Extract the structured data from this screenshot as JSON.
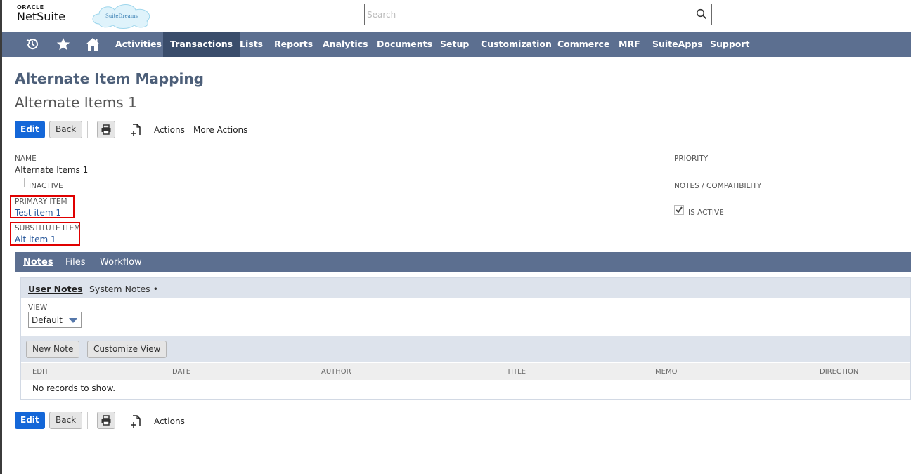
{
  "header": {
    "brand_top": "ORACLE",
    "brand_name": "NetSuite",
    "partner_logo_text": "SuiteDreams",
    "search_placeholder": "Search"
  },
  "nav": {
    "icons": [
      "recent-records-icon",
      "star-icon",
      "home-icon"
    ],
    "items": [
      "Activities",
      "Transactions",
      "Lists",
      "Reports",
      "Analytics",
      "Documents",
      "Setup",
      "Customization",
      "Commerce",
      "MRF",
      "SuiteApps",
      "Support"
    ],
    "active_item": "Transactions"
  },
  "page": {
    "title": "Alternate Item Mapping",
    "record_name": "Alternate Items 1"
  },
  "actions": {
    "edit": "Edit",
    "back": "Back",
    "actions": "Actions",
    "more_actions": "More Actions"
  },
  "fields": {
    "name_label": "NAME",
    "name_value": "Alternate Items 1",
    "inactive_label": "INACTIVE",
    "inactive_checked": false,
    "primary_item_label": "PRIMARY ITEM",
    "primary_item_value": "Test item 1",
    "substitute_item_label": "SUBSTITUTE ITEM",
    "substitute_item_value": "Alt item 1",
    "priority_label": "PRIORITY",
    "notes_label": "NOTES / COMPATIBILITY",
    "is_active_label": "IS ACTIVE",
    "is_active_checked": true
  },
  "tabs": {
    "items": [
      "Notes",
      "Files",
      "Workflow"
    ],
    "active": "Notes"
  },
  "notes": {
    "subtabs": [
      "User Notes",
      "System Notes •"
    ],
    "view_label": "VIEW",
    "view_value": "Default",
    "new_note": "New Note",
    "customize_view": "Customize View",
    "columns": [
      "EDIT",
      "DATE",
      "AUTHOR",
      "TITLE",
      "MEMO",
      "DIRECTION"
    ],
    "empty_message": "No records to show."
  },
  "colors": {
    "nav_bg": "#5c6f90",
    "nav_active": "#3a4d6b",
    "primary_button": "#1467d8",
    "highlight_box": "#e00000",
    "link": "#255599"
  }
}
